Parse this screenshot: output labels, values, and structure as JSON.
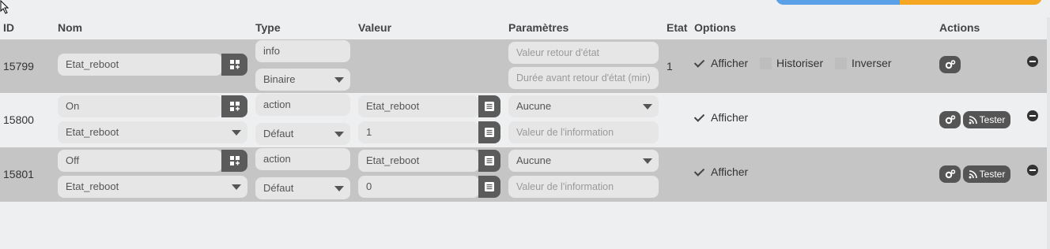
{
  "header": {
    "id": "ID",
    "nom": "Nom",
    "type": "Type",
    "valeur": "Valeur",
    "parametres": "Paramètres",
    "etat": "Etat",
    "options": "Options",
    "actions": "Actions"
  },
  "rows": [
    {
      "id": "15799",
      "name": "Etat_reboot",
      "type": "info",
      "subtype": "Binaire",
      "param1_placeholder": "Valeur retour d'état",
      "param2_placeholder": "Durée avant retour d'état (min)",
      "etat": "1",
      "afficher": "Afficher",
      "historiser": "Historiser",
      "inverser": "Inverser"
    },
    {
      "id": "15800",
      "name": "On",
      "linked": "Etat_reboot",
      "type": "action",
      "subtype": "Défaut",
      "value": "Etat_reboot",
      "value2": "1",
      "param_select": "Aucune",
      "param_placeholder": "Valeur de l'information",
      "afficher": "Afficher",
      "tester": "Tester"
    },
    {
      "id": "15801",
      "name": "Off",
      "linked": "Etat_reboot",
      "type": "action",
      "subtype": "Défaut",
      "value": "Etat_reboot",
      "value2": "0",
      "param_select": "Aucune",
      "param_placeholder": "Valeur de l'information",
      "afficher": "Afficher",
      "tester": "Tester"
    }
  ],
  "colors": {
    "grey_row": "#c5c5c5",
    "light_row": "#eeeff1",
    "button": "#555555",
    "top_blue": "#5aa0e6",
    "top_orange": "#f5a623"
  }
}
